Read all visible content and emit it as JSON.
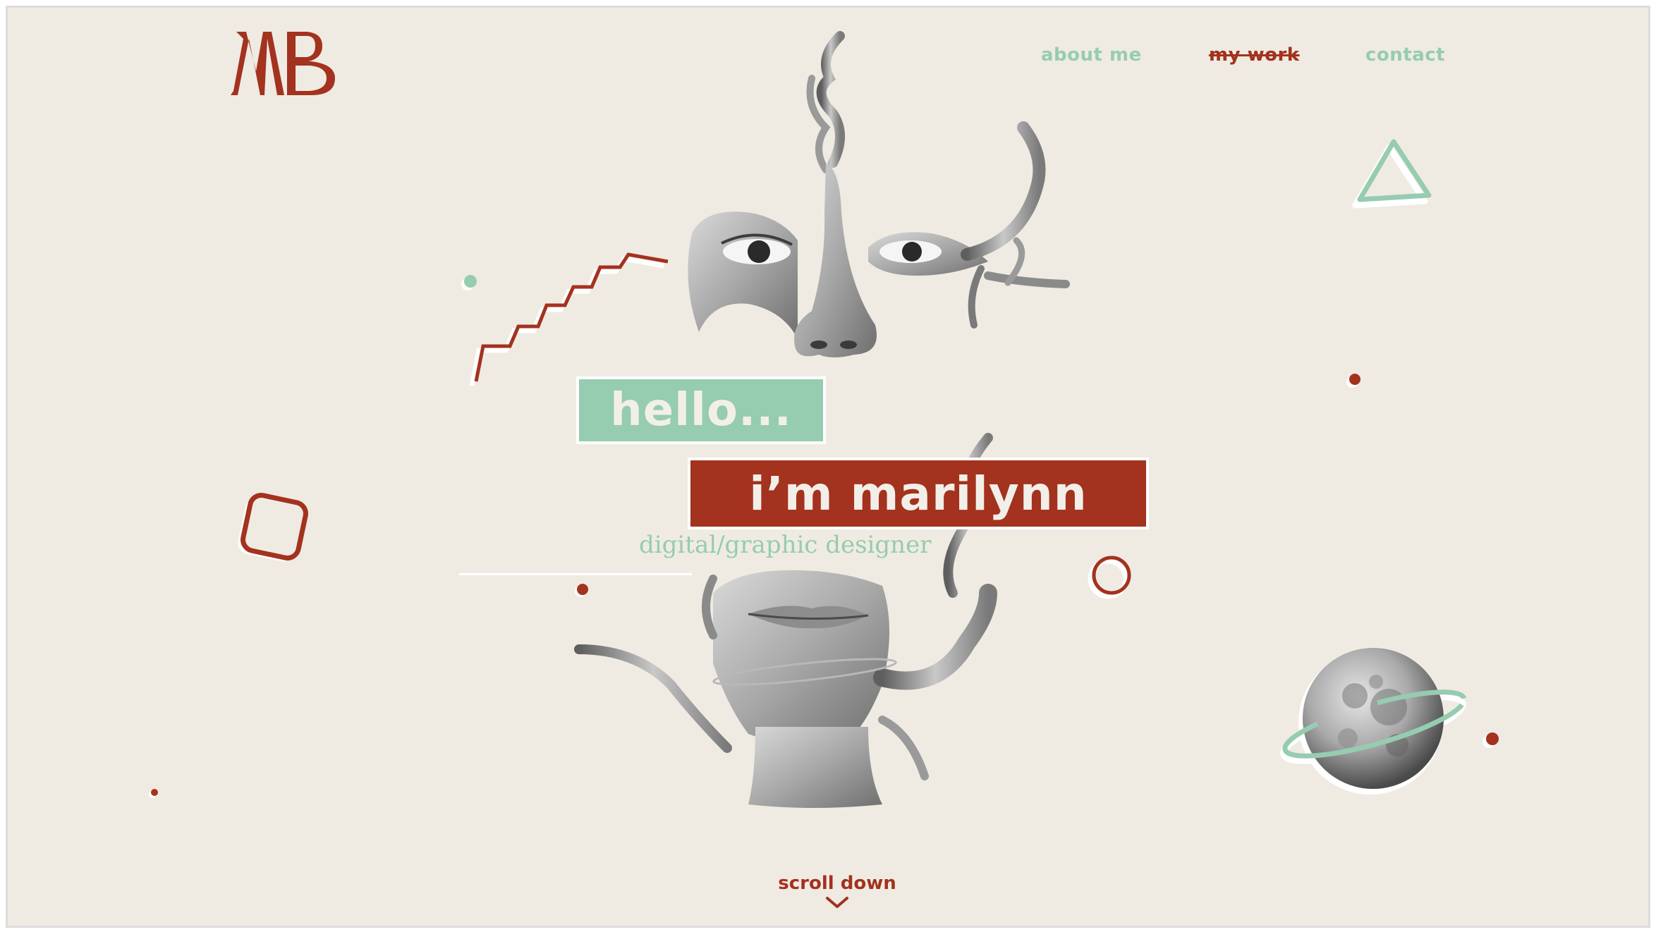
{
  "brand": {
    "logo_text": "MB",
    "logo_color": "#a3321e"
  },
  "nav": {
    "items": [
      {
        "label": "about me",
        "state": "default"
      },
      {
        "label": "my work",
        "state": "current"
      },
      {
        "label": "contact",
        "state": "default"
      }
    ]
  },
  "hero": {
    "greeting": "hello...",
    "name_line": "i’m marilynn",
    "role": "digital/graphic designer"
  },
  "scroll": {
    "label": "scroll down",
    "icon": "chevron-down-icon"
  },
  "colors": {
    "background": "#efebe3",
    "accent_red": "#a3321e",
    "accent_mint": "#96ccb0",
    "white": "#ffffff"
  },
  "illustration": {
    "description_icons": [
      "face-collage-illustration",
      "moon-planet-illustration"
    ]
  }
}
